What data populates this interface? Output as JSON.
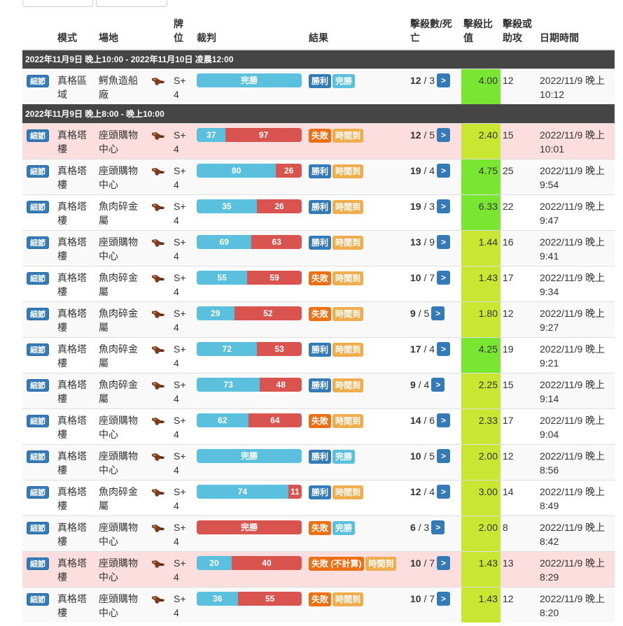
{
  "headers": {
    "mode": "模式",
    "stage": "場地",
    "rank": "牌位",
    "judge": "裁判",
    "result": "結果",
    "kd": "擊殺數/死亡",
    "ratio": "擊殺比值",
    "assist": "擊殺或助攻",
    "datetime": "日期時間"
  },
  "detail_label": "細節",
  "sections": [
    {
      "period": "2022年11月9日 晚上10:00 - 2022年11月10日 凌晨12:00",
      "rows": [
        {
          "mode": "真格區域",
          "stage": "鰐魚造船廠",
          "rank": "S+ 4",
          "bar": {
            "type": "full-blue",
            "label": "完勝"
          },
          "result": [
            "勝利",
            "完勝"
          ],
          "result_types": [
            "win",
            "ko"
          ],
          "kills": "12",
          "deaths": "3",
          "ratio": "4.00",
          "ratio_color": "green",
          "assist": "12",
          "datetime": "2022/11/9 晚上 10:12",
          "lose": false
        }
      ]
    },
    {
      "period": "2022年11月9日 晚上8:00 - 晚上10:00",
      "rows": [
        {
          "mode": "真格塔樓",
          "stage": "座頭購物中心",
          "rank": "S+ 4",
          "bar": {
            "type": "split",
            "left": "37",
            "right": "97"
          },
          "result": [
            "失敗",
            "時間到"
          ],
          "result_types": [
            "lose",
            "time"
          ],
          "kills": "12",
          "deaths": "5",
          "ratio": "2.40",
          "ratio_color": "lime",
          "assist": "15",
          "datetime": "2022/11/9 晚上 10:01",
          "lose": true
        },
        {
          "mode": "真格塔樓",
          "stage": "座頭購物中心",
          "rank": "S+ 4",
          "bar": {
            "type": "split",
            "left": "80",
            "right": "26"
          },
          "result": [
            "勝利",
            "時間到"
          ],
          "result_types": [
            "win",
            "time"
          ],
          "kills": "19",
          "deaths": "4",
          "ratio": "4.75",
          "ratio_color": "green",
          "assist": "25",
          "datetime": "2022/11/9 晚上 9:54",
          "lose": false
        },
        {
          "mode": "真格塔樓",
          "stage": "魚肉碎金屬",
          "rank": "S+ 4",
          "bar": {
            "type": "split",
            "left": "35",
            "right": "26"
          },
          "result": [
            "勝利",
            "時間到"
          ],
          "result_types": [
            "win",
            "time"
          ],
          "kills": "19",
          "deaths": "3",
          "ratio": "6.33",
          "ratio_color": "green",
          "assist": "22",
          "datetime": "2022/11/9 晚上 9:47",
          "lose": false
        },
        {
          "mode": "真格塔樓",
          "stage": "座頭購物中心",
          "rank": "S+ 4",
          "bar": {
            "type": "split",
            "left": "69",
            "right": "63"
          },
          "result": [
            "勝利",
            "時間到"
          ],
          "result_types": [
            "win",
            "time"
          ],
          "kills": "13",
          "deaths": "9",
          "ratio": "1.44",
          "ratio_color": "lime",
          "assist": "16",
          "datetime": "2022/11/9 晚上 9:41",
          "lose": false
        },
        {
          "mode": "真格塔樓",
          "stage": "魚肉碎金屬",
          "rank": "S+ 4",
          "bar": {
            "type": "split",
            "left": "55",
            "right": "59"
          },
          "result": [
            "失敗",
            "時間到"
          ],
          "result_types": [
            "lose",
            "time"
          ],
          "kills": "10",
          "deaths": "7",
          "ratio": "1.43",
          "ratio_color": "lime",
          "assist": "17",
          "datetime": "2022/11/9 晚上 9:34",
          "lose": false
        },
        {
          "mode": "真格塔樓",
          "stage": "魚肉碎金屬",
          "rank": "S+ 4",
          "bar": {
            "type": "split",
            "left": "29",
            "right": "52"
          },
          "result": [
            "失敗",
            "時間到"
          ],
          "result_types": [
            "lose",
            "time"
          ],
          "kills": "9",
          "deaths": "5",
          "ratio": "1.80",
          "ratio_color": "lime",
          "assist": "12",
          "datetime": "2022/11/9 晚上 9:27",
          "lose": false
        },
        {
          "mode": "真格塔樓",
          "stage": "魚肉碎金屬",
          "rank": "S+ 4",
          "bar": {
            "type": "split",
            "left": "72",
            "right": "53"
          },
          "result": [
            "勝利",
            "時間到"
          ],
          "result_types": [
            "win",
            "time"
          ],
          "kills": "17",
          "deaths": "4",
          "ratio": "4.25",
          "ratio_color": "green",
          "assist": "19",
          "datetime": "2022/11/9 晚上 9:21",
          "lose": false
        },
        {
          "mode": "真格塔樓",
          "stage": "魚肉碎金屬",
          "rank": "S+ 4",
          "bar": {
            "type": "split",
            "left": "73",
            "right": "48"
          },
          "result": [
            "勝利",
            "時間到"
          ],
          "result_types": [
            "win",
            "time"
          ],
          "kills": "9",
          "deaths": "4",
          "ratio": "2.25",
          "ratio_color": "lime",
          "assist": "15",
          "datetime": "2022/11/9 晚上 9:14",
          "lose": false
        },
        {
          "mode": "真格塔樓",
          "stage": "座頭購物中心",
          "rank": "S+ 4",
          "bar": {
            "type": "split",
            "left": "62",
            "right": "64"
          },
          "result": [
            "失敗",
            "時間到"
          ],
          "result_types": [
            "lose",
            "time"
          ],
          "kills": "14",
          "deaths": "6",
          "ratio": "2.33",
          "ratio_color": "lime",
          "assist": "17",
          "datetime": "2022/11/9 晚上 9:04",
          "lose": false
        },
        {
          "mode": "真格塔樓",
          "stage": "座頭購物中心",
          "rank": "S+ 4",
          "bar": {
            "type": "full-blue",
            "label": "完勝"
          },
          "result": [
            "勝利",
            "完勝"
          ],
          "result_types": [
            "win",
            "ko"
          ],
          "kills": "10",
          "deaths": "5",
          "ratio": "2.00",
          "ratio_color": "lime",
          "assist": "12",
          "datetime": "2022/11/9 晚上 8:56",
          "lose": false
        },
        {
          "mode": "真格塔樓",
          "stage": "魚肉碎金屬",
          "rank": "S+ 4",
          "bar": {
            "type": "split",
            "left": "74",
            "right": "11"
          },
          "result": [
            "勝利",
            "時間到"
          ],
          "result_types": [
            "win",
            "time"
          ],
          "kills": "12",
          "deaths": "4",
          "ratio": "3.00",
          "ratio_color": "lime",
          "assist": "14",
          "datetime": "2022/11/9 晚上 8:49",
          "lose": false
        },
        {
          "mode": "真格塔樓",
          "stage": "座頭購物中心",
          "rank": "S+ 4",
          "bar": {
            "type": "full-red",
            "label": "完勝"
          },
          "result": [
            "失敗",
            "完勝"
          ],
          "result_types": [
            "lose",
            "ko"
          ],
          "kills": "6",
          "deaths": "3",
          "ratio": "2.00",
          "ratio_color": "lime",
          "assist": "8",
          "datetime": "2022/11/9 晚上 8:42",
          "lose": false
        },
        {
          "mode": "真格塔樓",
          "stage": "座頭購物中心",
          "rank": "S+ 4",
          "bar": {
            "type": "split",
            "left": "20",
            "right": "40"
          },
          "result": [
            "失敗 (不計算)",
            "時間到"
          ],
          "result_types": [
            "lose",
            "time"
          ],
          "kills": "10",
          "deaths": "7",
          "ratio": "1.43",
          "ratio_color": "lime",
          "assist": "13",
          "datetime": "2022/11/9 晚上 8:29",
          "lose": true
        },
        {
          "mode": "真格塔樓",
          "stage": "座頭購物中心",
          "rank": "S+ 4",
          "bar": {
            "type": "split",
            "left": "36",
            "right": "55"
          },
          "result": [
            "失敗",
            "時間到"
          ],
          "result_types": [
            "lose",
            "time"
          ],
          "kills": "10",
          "deaths": "7",
          "ratio": "1.43",
          "ratio_color": "lime",
          "assist": "12",
          "datetime": "2022/11/9 晚上 8:20",
          "lose": false
        }
      ]
    }
  ]
}
